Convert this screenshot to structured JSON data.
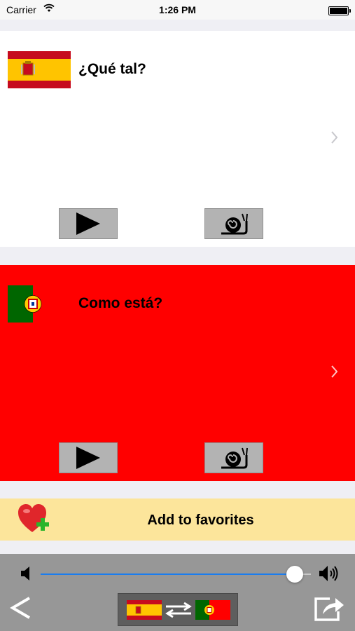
{
  "status_bar": {
    "carrier": "Carrier",
    "time": "1:26 PM"
  },
  "source_card": {
    "flag": "spain-flag",
    "phrase": "¿Qué tal?",
    "background": "#ffffff",
    "play_icon": "play-icon",
    "slow_icon": "snail-icon",
    "chevron_icon": "chevron-right-icon"
  },
  "target_card": {
    "flag": "portugal-flag",
    "phrase": "Como está?",
    "background": "#ff0000",
    "play_icon": "play-icon",
    "slow_icon": "snail-icon",
    "chevron_icon": "chevron-right-icon"
  },
  "favorites": {
    "label": "Add to favorites",
    "icon": "heart-plus-icon",
    "background": "#fce59b"
  },
  "toolbar": {
    "volume_level": 0.94,
    "volume_low_icon": "speaker-low-icon",
    "volume_high_icon": "speaker-high-icon",
    "back_icon": "back-chevron-icon",
    "swap_icon": "swap-languages-icon",
    "share_icon": "share-icon",
    "accent": "#1a7df0"
  }
}
